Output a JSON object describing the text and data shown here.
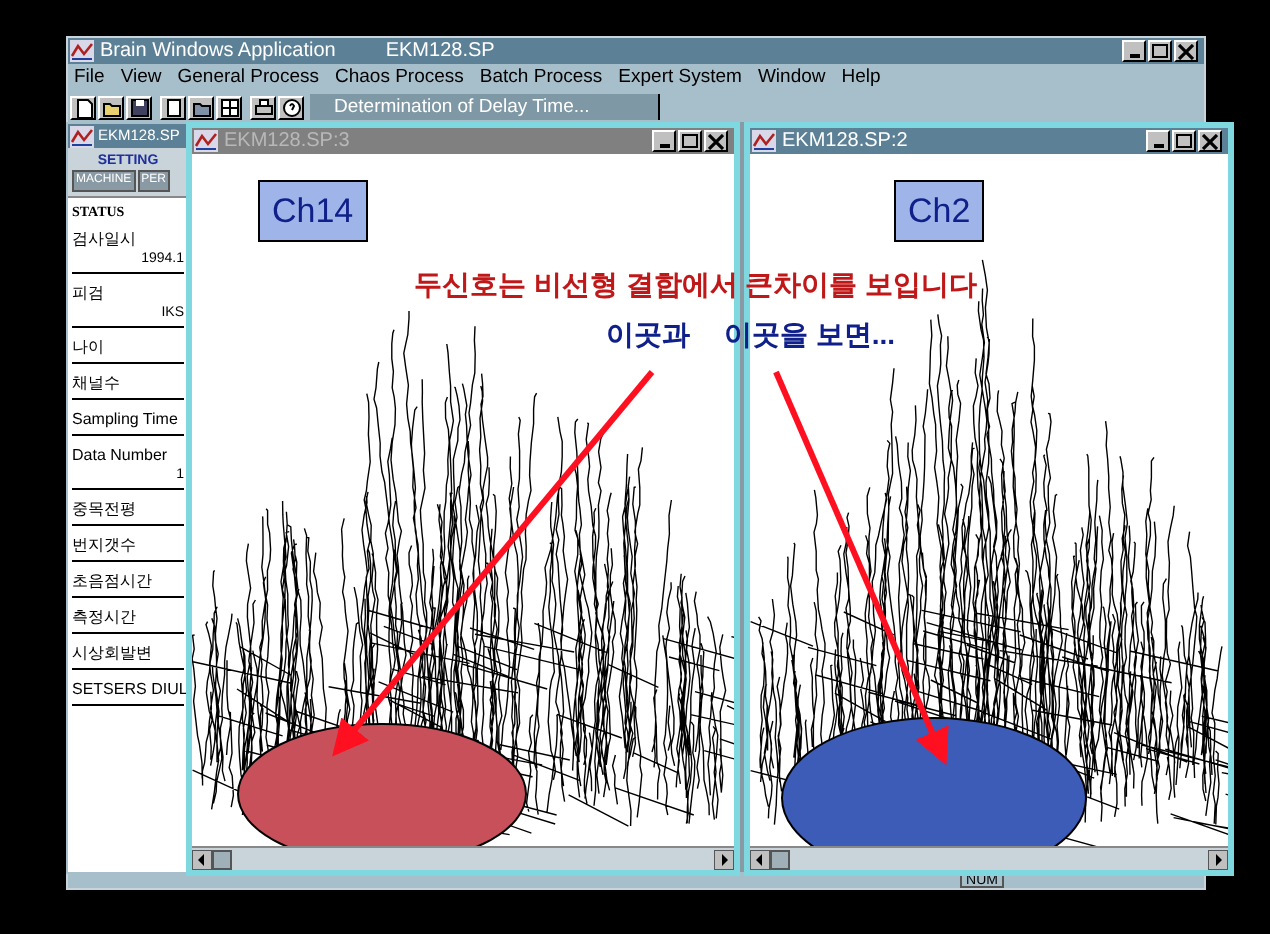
{
  "app_window": {
    "title": "Brain Windows Application",
    "document": "EKM128.SP"
  },
  "menu": [
    "File",
    "View",
    "General Process",
    "Chaos Process",
    "Batch Process",
    "Expert System",
    "Window",
    "Help"
  ],
  "toolbar": {
    "combo": "Determination of Delay Time..."
  },
  "status_panel": {
    "title": "EKM128.SP",
    "setting_label": "SETTING",
    "buttons": [
      "MACHINE",
      "PER"
    ],
    "group_label": "STATUS",
    "fields": [
      {
        "label": "검사일시",
        "value": "1994.1"
      },
      {
        "label": "피검",
        "value": "IKS"
      },
      {
        "label": "나이"
      },
      {
        "label": "채널수"
      },
      {
        "label": "Sampling Time"
      },
      {
        "label": "Data Number",
        "value": "1"
      },
      {
        "label": "중목전평"
      },
      {
        "label": "번지갯수"
      },
      {
        "label": "초음점시간"
      },
      {
        "label": "측정시간"
      },
      {
        "label": "시상회발변"
      },
      {
        "label": "SETSERS DIUL"
      }
    ]
  },
  "child_windows": [
    {
      "title": "EKM128.SP:3",
      "active": false,
      "channel": "Ch14"
    },
    {
      "title": "EKM128.SP:2",
      "active": true,
      "channel": "Ch2"
    }
  ],
  "annotations": {
    "headline": "두신호는 비선형 결합에서 큰차이를 보입니다",
    "notes": [
      "이곳과",
      "이곳을 보면..."
    ]
  },
  "status_bar": {
    "indicator": "NUM"
  }
}
